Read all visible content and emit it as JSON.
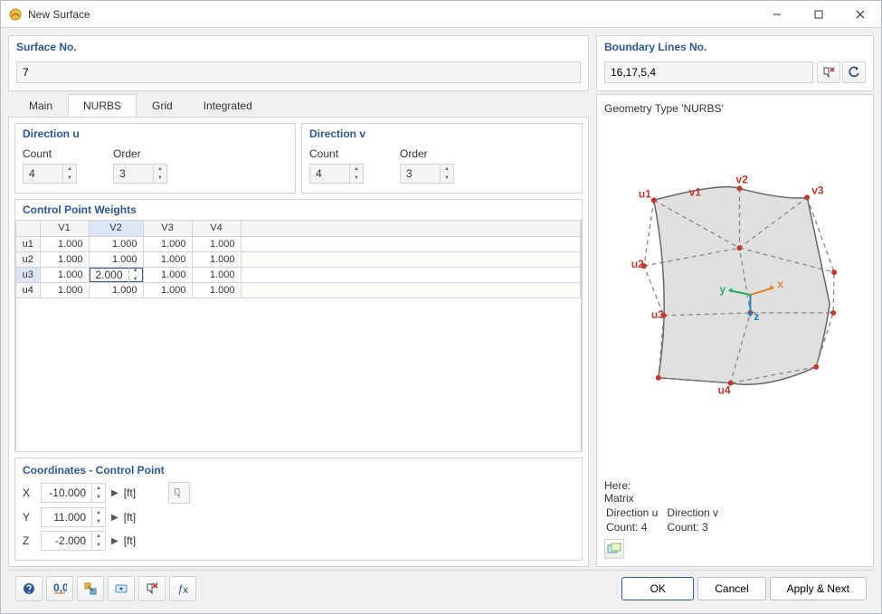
{
  "window": {
    "title": "New Surface"
  },
  "surface_no": {
    "label": "Surface No.",
    "value": "7"
  },
  "boundary": {
    "label": "Boundary Lines No.",
    "value": "16,17,5,4"
  },
  "tabs": [
    {
      "key": "main",
      "label": "Main",
      "active": false
    },
    {
      "key": "nurbs",
      "label": "NURBS",
      "active": true
    },
    {
      "key": "grid",
      "label": "Grid",
      "active": false
    },
    {
      "key": "integrated",
      "label": "Integrated",
      "active": false
    }
  ],
  "direction_u": {
    "label": "Direction u",
    "count_label": "Count",
    "count": "4",
    "order_label": "Order",
    "order": "3"
  },
  "direction_v": {
    "label": "Direction v",
    "count_label": "Count",
    "count": "4",
    "order_label": "Order",
    "order": "3"
  },
  "cpw": {
    "label": "Control Point Weights",
    "cols": [
      "V1",
      "V2",
      "V3",
      "V4"
    ],
    "rows": [
      "u1",
      "u2",
      "u3",
      "u4"
    ],
    "data": [
      [
        "1.000",
        "1.000",
        "1.000",
        "1.000"
      ],
      [
        "1.000",
        "1.000",
        "1.000",
        "1.000"
      ],
      [
        "1.000",
        "2.000",
        "1.000",
        "1.000"
      ],
      [
        "1.000",
        "1.000",
        "1.000",
        "1.000"
      ]
    ],
    "selected_row": 2,
    "selected_col": 1
  },
  "coord": {
    "label": "Coordinates - Control Point",
    "unit": "[ft]",
    "X": {
      "label": "X",
      "value": "-10.000"
    },
    "Y": {
      "label": "Y",
      "value": "11.000"
    },
    "Z": {
      "label": "Z",
      "value": "-2.000"
    }
  },
  "preview": {
    "title": "Geometry Type 'NURBS'",
    "here": "Here:",
    "matrix": "Matrix",
    "du_label": "Direction u",
    "dv_label": "Direction v",
    "du_count": "Count: 4",
    "dv_count": "Count: 3",
    "labels": {
      "v1": "v1",
      "v2": "v2",
      "v3": "v3",
      "u1": "u1",
      "u2": "u2",
      "u3": "u3",
      "u4": "u4"
    },
    "axes": {
      "x": "x",
      "y": "y",
      "z": "z"
    }
  },
  "footer": {
    "ok": "OK",
    "cancel": "Cancel",
    "apply_next": "Apply & Next"
  }
}
